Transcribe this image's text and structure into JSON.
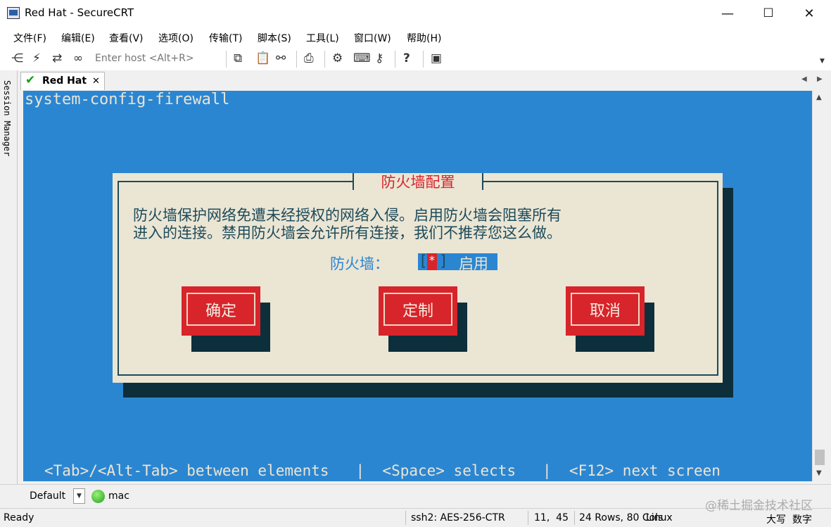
{
  "window": {
    "title": "Red Hat - SecureCRT",
    "minimize": "—",
    "maximize": "☐",
    "close": "✕"
  },
  "menu": [
    "文件(F)",
    "编辑(E)",
    "查看(V)",
    "选项(O)",
    "传输(T)",
    "脚本(S)",
    "工具(L)",
    "窗口(W)",
    "帮助(H)"
  ],
  "toolbar": {
    "host_placeholder": "Enter host <Alt+R>"
  },
  "sidebar": {
    "label": "Session Manager"
  },
  "tab": {
    "label": "Red Hat",
    "close": "✕",
    "scroll_left": "◀",
    "scroll_right": "▶"
  },
  "terminal": {
    "command": "system-config-firewall",
    "dialog": {
      "title": "防火墙配置",
      "line1": "防火墙保护网络免遭未经授权的网络入侵。启用防火墙会阻塞所有",
      "line2": "进入的连接。禁用防火墙会允许所有连接，我们不推荐您这么做。",
      "field_label": "防火墙：",
      "checkbox_open": "[",
      "checkbox_mark": "*",
      "checkbox_close": "]",
      "field_value": "启用",
      "buttons": [
        "确定",
        "定制",
        "取消"
      ]
    },
    "help_line": "<Tab>/<Alt-Tab> between elements   |  <Space> selects   |  <F12> next screen",
    "colors": {
      "background": "#2b86d2",
      "dialog": "#ebe5d4",
      "button": "#d8242b",
      "shadow": "#0d2f3b",
      "title": "#d8242b",
      "label": "#2b86d2"
    }
  },
  "bottombar": {
    "session_select": "Default",
    "connection": "mac"
  },
  "status": {
    "ready": "Ready",
    "cipher": "ssh2: AES-256-CTR",
    "cursor": "11,  45",
    "size": "24 Rows, 80 Cols",
    "os": "Linux",
    "caps": "大写",
    "num": "数字"
  },
  "watermark": "@稀土掘金技术社区"
}
